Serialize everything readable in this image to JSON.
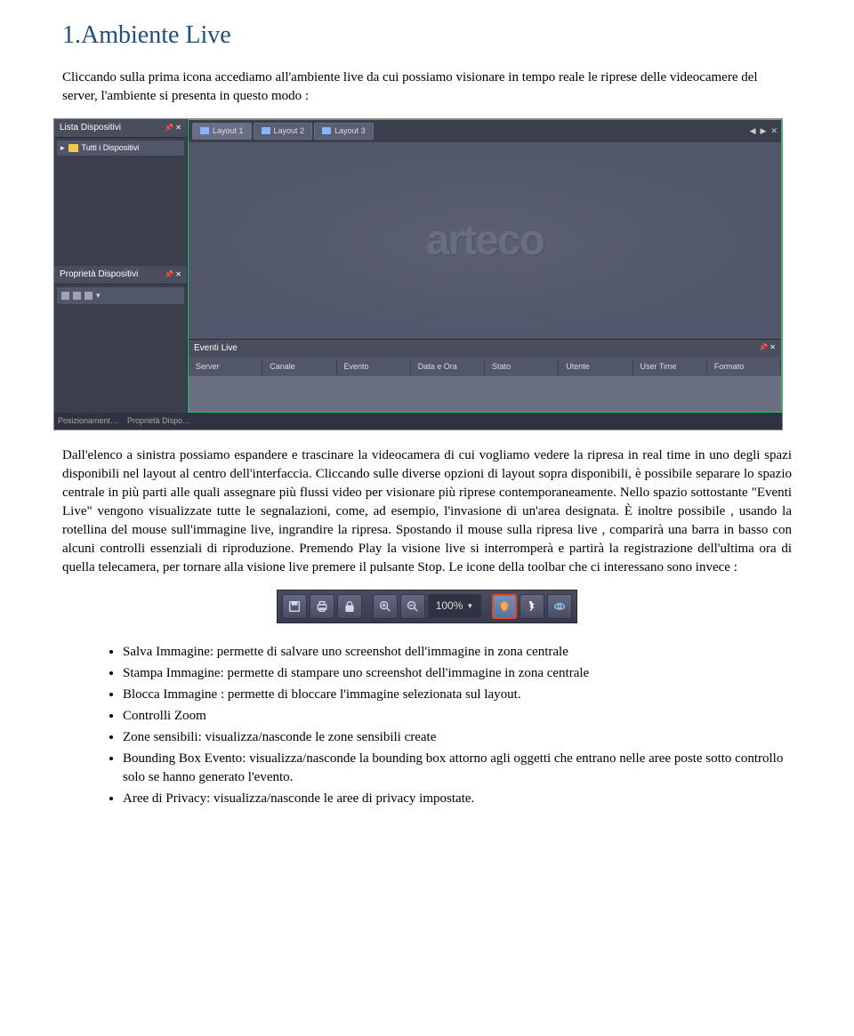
{
  "heading": "1.Ambiente Live",
  "intro": "Cliccando sulla prima icona accediamo all'ambiente live da cui possiamo visionare in tempo reale le riprese delle videocamere del server, l'ambiente si presenta in questo modo :",
  "screenshot": {
    "left_panel1_title": "Lista Dispositivi",
    "left_panel1_item": "Tutti i Dispositivi",
    "left_panel2_title": "Proprietà Dispositivi",
    "tabs": [
      "Layout 1",
      "Layout 2",
      "Layout 3"
    ],
    "logo": "arteco",
    "events_title": "Eventi Live",
    "event_cols": [
      "Server",
      "Canale",
      "Evento",
      "Data e Ora",
      "Stato",
      "Utente",
      "User Time",
      "Formato"
    ],
    "bottom_tabs": [
      "Posizionament…",
      "Proprietà Dispo…"
    ]
  },
  "middle": "Dall'elenco a sinistra possiamo espandere e trascinare la videocamera di cui vogliamo vedere la ripresa in real time in uno degli spazi disponibili nel layout al centro dell'interfaccia. Cliccando sulle diverse opzioni di layout sopra disponibili, è possibile separare lo spazio centrale in più parti alle quali assegnare più flussi video per visionare più riprese contemporaneamente. Nello spazio sottostante \"Eventi Live\" vengono visualizzate tutte le segnalazioni, come, ad esempio, l'invasione di un'area designata. È inoltre possibile , usando la rotellina del mouse sull'immagine live, ingrandire la ripresa. Spostando il mouse sulla ripresa live , comparirà una barra in basso con alcuni controlli essenziali di riproduzione. Premendo Play la visione live si interromperà e partirà la registrazione dell'ultima ora di quella telecamera, per tornare alla visione live premere il pulsante Stop. Le icone della toolbar che ci interessano sono invece :",
  "toolbar": {
    "zoom": "100%"
  },
  "bullets": [
    "Salva Immagine: permette di salvare uno screenshot dell'immagine in zona centrale",
    "Stampa Immagine: permette di stampare uno screenshot dell'immagine in zona centrale",
    "Blocca Immagine : permette di bloccare l'immagine selezionata sul layout.",
    "Controlli Zoom",
    "Zone sensibili: visualizza/nasconde le zone sensibili create",
    "Bounding Box Evento: visualizza/nasconde la bounding box attorno agli oggetti che entrano nelle aree poste sotto controllo solo se hanno generato l'evento.",
    "Aree di Privacy: visualizza/nasconde le aree di privacy impostate."
  ]
}
